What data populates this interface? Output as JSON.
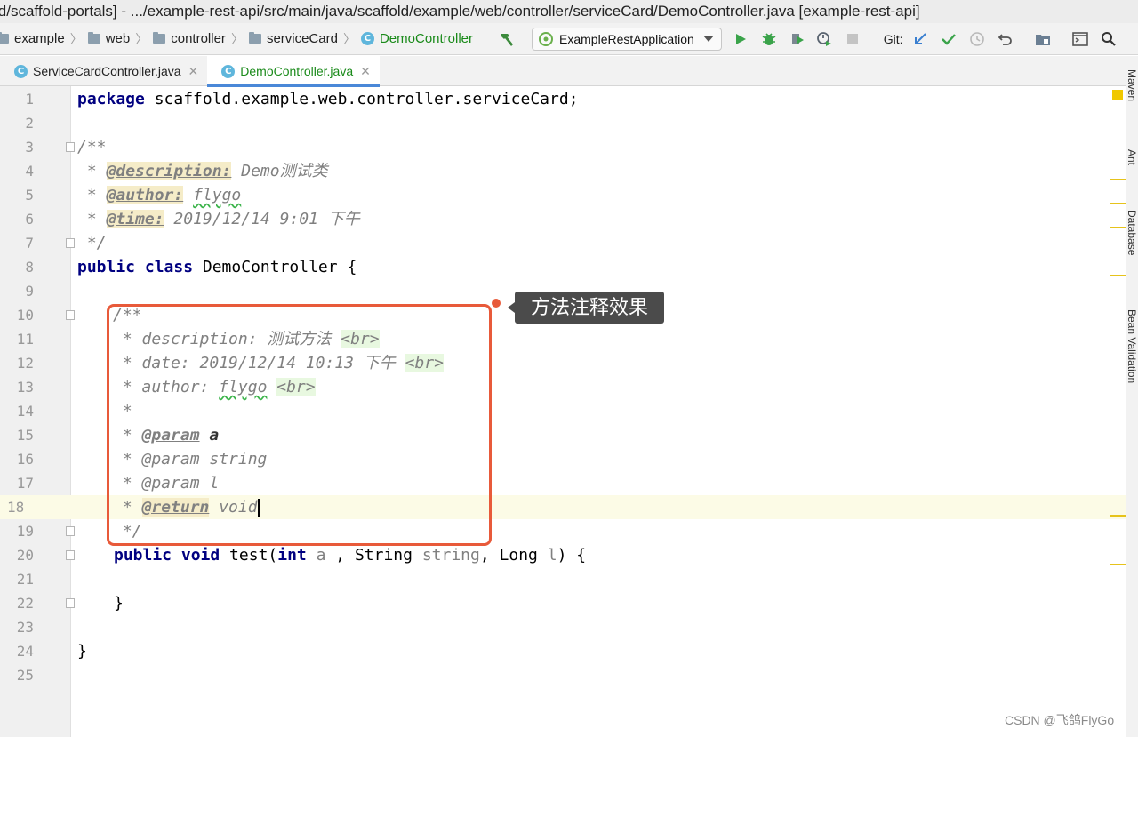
{
  "window": {
    "title": "ld/scaffold-portals] - .../example-rest-api/src/main/java/scaffold/example/web/controller/serviceCard/DemoController.java [example-rest-api]"
  },
  "breadcrumb": {
    "items": [
      "example",
      "web",
      "controller",
      "serviceCard"
    ],
    "current": "DemoController"
  },
  "toolbar": {
    "run_config": "ExampleRestApplication",
    "git_label": "Git:"
  },
  "tabs": [
    {
      "label": "ServiceCardController.java",
      "active": false
    },
    {
      "label": "DemoController.java",
      "active": true
    }
  ],
  "editor": {
    "line_numbers": [
      "1",
      "2",
      "3",
      "4",
      "5",
      "6",
      "7",
      "8",
      "9",
      "10",
      "11",
      "12",
      "13",
      "14",
      "15",
      "16",
      "17",
      "18",
      "19",
      "20",
      "21",
      "22",
      "23",
      "24",
      "25"
    ],
    "current_line": "18",
    "lines": {
      "l1_kw": "package",
      "l1_rest": " scaffold.example.web.controller.serviceCard;",
      "l3": "/**",
      "l4_tag": "@description:",
      "l4_text": " Demo测试类",
      "l5_tag": "@author:",
      "l5_text": "flygo",
      "l6_tag": "@time:",
      "l6_text": " 2019/12/14 9:01 下午",
      "l7": " */",
      "l8_kw": "public class",
      "l8_rest": " DemoController {",
      "l10": "/**",
      "l11_text": " * description: 测试方法 ",
      "l12_text": " * date: 2019/12/14 10:13 下午 ",
      "l13_text": " * author: ",
      "l13_name": "flygo",
      "br": "<br>",
      "l14": " *",
      "l15_tag": "@param",
      "l15_text": "a",
      "l16": " * @param string",
      "l17": " * @param l",
      "l18_tag": "@return",
      "l18_text": "void",
      "l19": " */",
      "l20_kw1": "public void",
      "l20_fn": " test(",
      "l20_int": "int",
      "l20_a": " a ",
      "l20_mid": ", String ",
      "l20_string": "string",
      "l20_mid2": ", Long ",
      "l20_l": "l",
      "l20_end": ") {",
      "l22": "}",
      "l24": "}",
      "star": " * "
    }
  },
  "annotation": {
    "label": "方法注释效果"
  },
  "sidebar": {
    "items": [
      "Maven",
      "Ant",
      "Database",
      "Bean Validation"
    ]
  },
  "watermark": "CSDN @飞鸽FlyGo",
  "colors": {
    "keyword": "#000080",
    "doc_comment": "#808080",
    "callout_border": "#e85a3a",
    "active_tab_underline": "#4a88d8"
  }
}
